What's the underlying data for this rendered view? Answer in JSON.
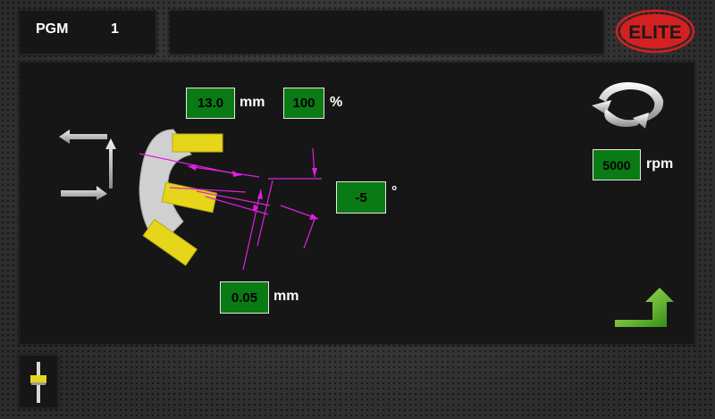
{
  "header": {
    "pgm_label": "PGM",
    "pgm_number": "1",
    "title_text": "",
    "logo_text": "ELITE"
  },
  "fields": {
    "feed_value": "13.0",
    "feed_unit": "mm",
    "speed_percent_value": "100",
    "speed_percent_unit": "%",
    "angle_value": "-5",
    "angle_unit": "°",
    "rpm_value": "5000",
    "rpm_unit": "rpm",
    "depth_value": "0.05",
    "depth_unit": "mm"
  },
  "icons": {
    "logo": "elite-logo",
    "direction": "direction-arrows-icon",
    "rotation": "rotation-icon",
    "next": "turn-up-arrow-icon",
    "side": "slider-icon"
  },
  "colors": {
    "field_bg": "#0a7a14",
    "insert_yellow": "#e6d61a",
    "dimension_magenta": "#e020e0",
    "logo_red": "#d42020"
  }
}
